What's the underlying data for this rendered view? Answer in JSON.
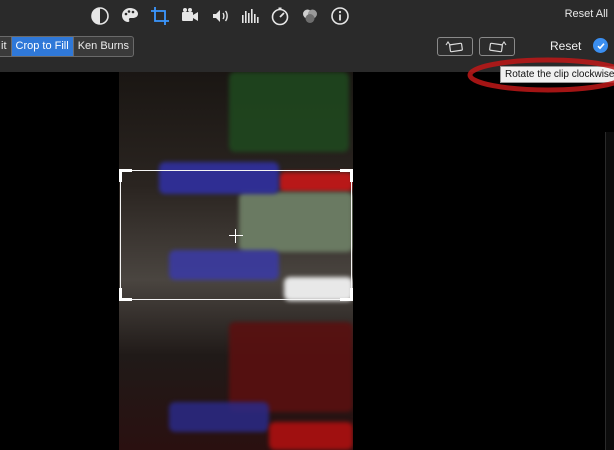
{
  "toolbar": {
    "icons": [
      "color-balance-icon",
      "color-palette-icon",
      "crop-icon",
      "video-camera-icon",
      "volume-icon",
      "equalizer-icon",
      "speed-icon",
      "filters-icon",
      "info-icon"
    ],
    "active_icon": "crop-icon",
    "reset_all_label": "Reset All"
  },
  "crop_modes": {
    "items": [
      "Fit",
      "Crop to Fill",
      "Ken Burns"
    ],
    "visible_text": [
      "it",
      "Crop to Fill",
      "Ken Burns"
    ],
    "selected": "Crop to Fill"
  },
  "rotate": {
    "left_icon": "rotate-counterclockwise-icon",
    "right_icon": "rotate-clockwise-icon"
  },
  "reset_label": "Reset",
  "tooltip_text": "Rotate the clip clockwise",
  "colors": {
    "accent": "#2f78d8",
    "annotation": "#c01818"
  }
}
